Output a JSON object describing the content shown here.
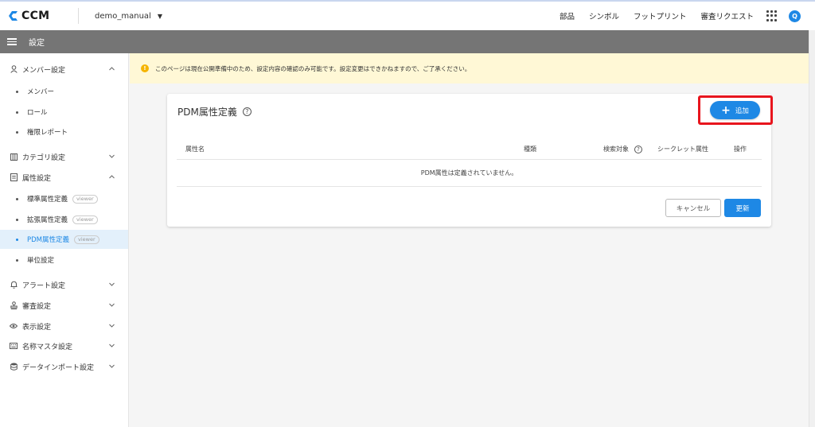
{
  "app": {
    "logo_text": "CCM",
    "project_name": "demo_manual",
    "nav": [
      "部品",
      "シンボル",
      "フットプリント",
      "審査リクエスト"
    ],
    "user_initial": "Q"
  },
  "subheader": {
    "title": "設定"
  },
  "sidebar": {
    "sections": [
      {
        "label": "メンバー設定",
        "icon": "person-icon",
        "expanded": true
      },
      {
        "label": "カテゴリ設定",
        "icon": "category-icon",
        "expanded": false
      },
      {
        "label": "属性設定",
        "icon": "document-icon",
        "expanded": true
      },
      {
        "label": "アラート設定",
        "icon": "bell-icon",
        "expanded": false
      },
      {
        "label": "審査設定",
        "icon": "stamp-icon",
        "expanded": false
      },
      {
        "label": "表示設定",
        "icon": "eye-icon",
        "expanded": false
      },
      {
        "label": "名称マスタ設定",
        "icon": "keyboard-icon",
        "expanded": false
      },
      {
        "label": "データインポート設定",
        "icon": "database-icon",
        "expanded": false
      }
    ],
    "items": [
      {
        "label": "メンバー"
      },
      {
        "label": "ロール"
      },
      {
        "label": "権限レポート"
      },
      {
        "label": "標準属性定義",
        "tag": "viewer"
      },
      {
        "label": "拡張属性定義",
        "tag": "viewer"
      },
      {
        "label": "PDM属性定義",
        "tag": "viewer",
        "active": true
      },
      {
        "label": "単位設定"
      }
    ]
  },
  "notice": {
    "text": "このページは現在公開準備中のため、設定内容の確認のみ可能です。設定変更はできかねますので、ご了承ください。"
  },
  "card": {
    "title": "PDM属性定義",
    "add_label": "追加",
    "columns": [
      "属性名",
      "種類",
      "検索対象",
      "シークレット属性",
      "操作"
    ],
    "empty_message": "PDM属性は定義されていません。",
    "cancel_label": "キャンセル",
    "update_label": "更新"
  },
  "colors": {
    "accent": "#1e88e5",
    "subheader": "#757575",
    "notice_bg": "#fff8d6",
    "highlight": "#e8151d"
  }
}
